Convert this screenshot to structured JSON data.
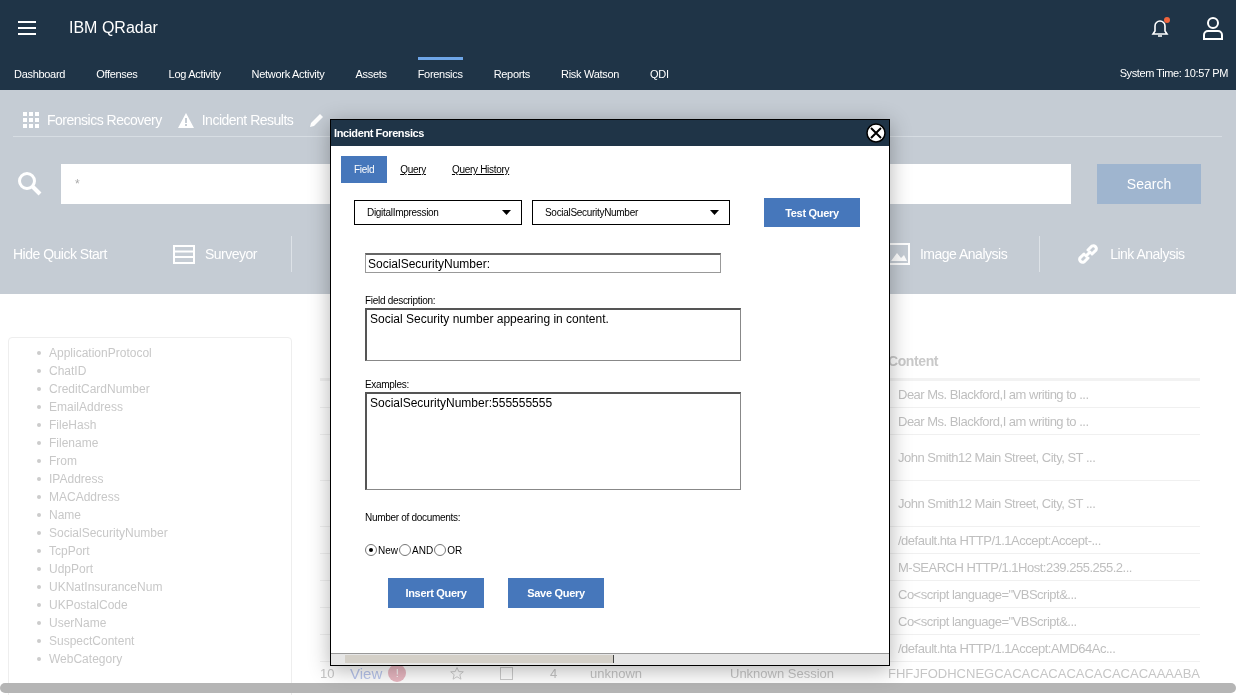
{
  "header": {
    "title": "IBM QRadar"
  },
  "nav": {
    "items": [
      {
        "label": "Dashboard",
        "selected": false
      },
      {
        "label": "Offenses",
        "selected": false
      },
      {
        "label": "Log Activity",
        "selected": false
      },
      {
        "label": "Network Activity",
        "selected": false
      },
      {
        "label": "Assets",
        "selected": false
      },
      {
        "label": "Forensics",
        "selected": true
      },
      {
        "label": "Reports",
        "selected": false
      },
      {
        "label": "Risk Watson",
        "selected": false
      },
      {
        "label": "QDI",
        "selected": false
      }
    ],
    "system_time": "System Time: 10:57 PM"
  },
  "toolbar": [
    {
      "kind": "grid",
      "label": "Forensics Recovery"
    },
    {
      "kind": "warning",
      "label": "Incident Results"
    }
  ],
  "search": {
    "value": "*",
    "button": "Search"
  },
  "quick_start": {
    "hide": "Hide Quick Start",
    "items": [
      {
        "kind": "list",
        "label": "Surveyor"
      },
      {
        "kind": "image",
        "label": "Image Analysis"
      },
      {
        "kind": "link",
        "label": "Link Analysis"
      }
    ]
  },
  "sidebar": {
    "fields": [
      "ApplicationProtocol",
      "ChatID",
      "CreditCardNumber",
      "EmailAddress",
      "FileHash",
      "Filename",
      "From",
      "IPAddress",
      "MACAddress",
      "Name",
      "SocialSecurityNumber",
      "TcpPort",
      "UdpPort",
      "UKNatInsuranceNum",
      "UKPostalCode",
      "UserName",
      "SuspectContent",
      "WebCategory"
    ]
  },
  "table": {
    "columns": [
      "Content"
    ],
    "rows": [
      {
        "content": "Dear Ms. Blackford,I am writing to ...",
        "tall": false
      },
      {
        "content": "Dear Ms. Blackford,I am writing to ...",
        "tall": false
      },
      {
        "content": "John Smith12 Main Street, City, ST ...",
        "tall": true
      },
      {
        "content": "John Smith12 Main Street, City, ST ...",
        "tall": true
      },
      {
        "content": "/default.hta HTTP/1.1Accept:Accept-...",
        "tall": false
      },
      {
        "content": "M-SEARCH HTTP/1.1Host:239.255.255.2...",
        "tall": false
      },
      {
        "content": "Co<script language=\"VBScript&...",
        "tall": false
      },
      {
        "content": "Co<script language=\"VBScript&...",
        "tall": false
      },
      {
        "content": "/default.hta HTTP/1.1Accept:AMD64Ac...",
        "tall": false
      }
    ],
    "last_row": {
      "number": "10",
      "link": "View",
      "badge": "!",
      "checked": false,
      "count": "4",
      "column_5": "unknown",
      "column_6": "Unknown Session",
      "content": "FHFJFODHCNEGCACACACACACACACACAAAABA"
    }
  },
  "dialog": {
    "title": "Incident Forensics",
    "tabs": [
      {
        "label": "Field",
        "selected": true
      },
      {
        "label": "Query",
        "selected": false
      },
      {
        "label": "Query History",
        "selected": false
      }
    ],
    "dropdowns": [
      "DigitalImpression",
      "SocialSecurityNumber"
    ],
    "test_button": "Test Query",
    "field_value": "SocialSecurityNumber:",
    "description_label": "Field description:",
    "description": "Social Security number appearing in content.",
    "examples_label": "Examples:",
    "examples": "SocialSecurityNumber:555555555",
    "documents_label": "Number of documents:",
    "options": [
      {
        "label": "New",
        "selected": true
      },
      {
        "label": "AND",
        "selected": false
      },
      {
        "label": "OR",
        "selected": false
      }
    ],
    "buttons": [
      "Insert Query",
      "Save Query"
    ]
  }
}
